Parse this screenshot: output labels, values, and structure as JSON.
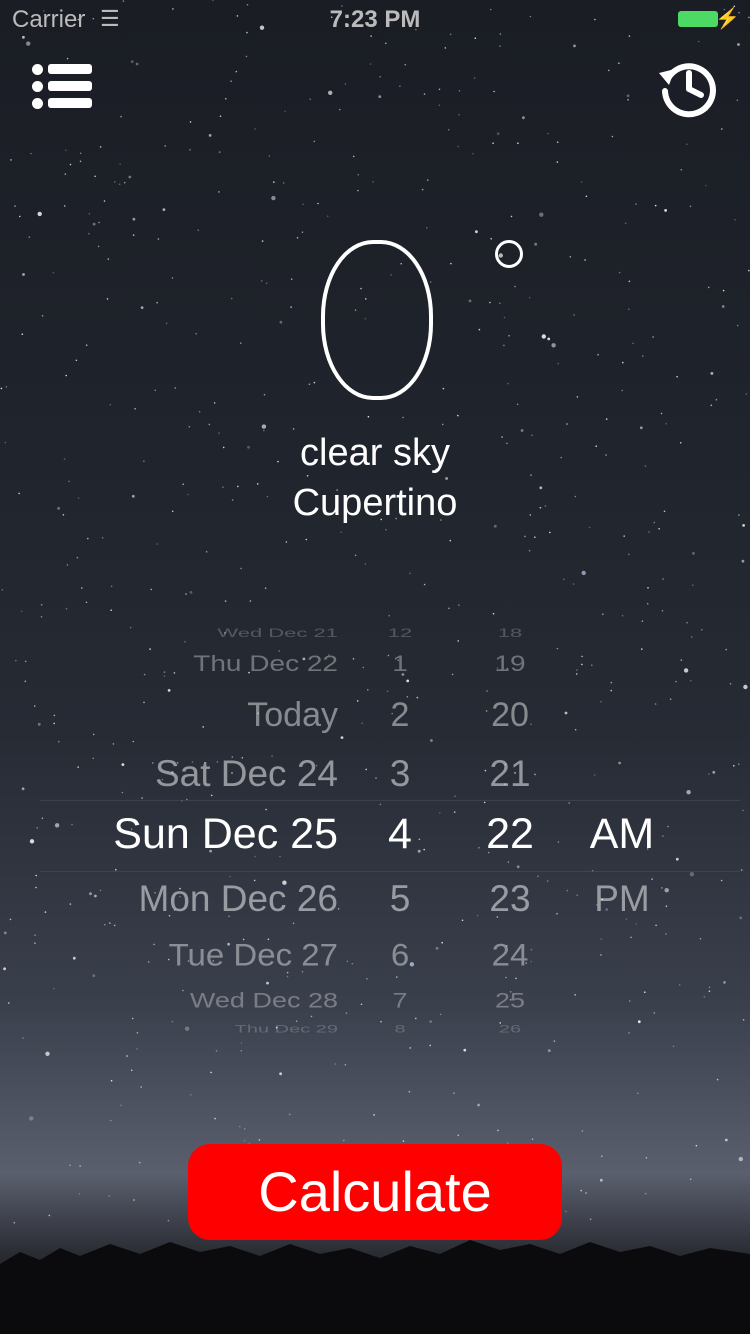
{
  "status_bar": {
    "carrier": "Carrier",
    "time": "7:23 PM",
    "battery_color": "#4cd964"
  },
  "header": {
    "left_icon": "list-icon",
    "right_icon": "history-icon"
  },
  "weather": {
    "temperature": "0",
    "condition": "clear sky",
    "city": "Cupertino"
  },
  "picker": {
    "dates": [
      "Wed Dec 21",
      "Thu Dec 22",
      "Today",
      "Sat Dec 24",
      "Sun Dec 25",
      "Mon Dec 26",
      "Tue Dec 27",
      "Wed Dec 28",
      "Thu Dec 29"
    ],
    "hours": [
      "12",
      "1",
      "2",
      "3",
      "4",
      "5",
      "6",
      "7",
      "8"
    ],
    "minutes": [
      "18",
      "19",
      "20",
      "21",
      "22",
      "23",
      "24",
      "25",
      "26"
    ],
    "ampm": [
      "AM",
      "PM"
    ],
    "selected": {
      "date": "Sun Dec 25",
      "hour": "4",
      "minute": "22",
      "ampm": "AM"
    }
  },
  "calculate_button": {
    "label": "Calculate",
    "color": "#ff0000"
  }
}
